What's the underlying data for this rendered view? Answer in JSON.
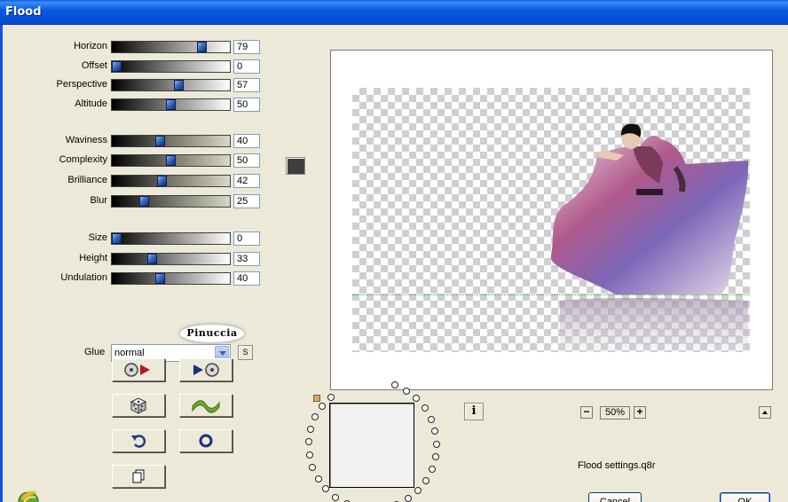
{
  "window": {
    "title": "Flood"
  },
  "params": [
    {
      "key": "horizon",
      "label": "Horizon",
      "value": "79",
      "fraction": 0.79
    },
    {
      "key": "offset",
      "label": "Offset",
      "value": "0",
      "fraction": 0.0
    },
    {
      "key": "perspective",
      "label": "Perspective",
      "value": "57",
      "fraction": 0.57
    },
    {
      "key": "altitude",
      "label": "Altitude",
      "value": "50",
      "fraction": 0.5
    },
    {
      "key": "waviness",
      "label": "Waviness",
      "value": "40",
      "fraction": 0.4
    },
    {
      "key": "complexity",
      "label": "Complexity",
      "value": "50",
      "fraction": 0.5
    },
    {
      "key": "brilliance",
      "label": "Brilliance",
      "value": "42",
      "fraction": 0.42
    },
    {
      "key": "blur",
      "label": "Blur",
      "value": "25",
      "fraction": 0.25
    },
    {
      "key": "size",
      "label": "Size",
      "value": "0",
      "fraction": 0.0
    },
    {
      "key": "height",
      "label": "Height",
      "value": "33",
      "fraction": 0.33
    },
    {
      "key": "undulation",
      "label": "Undulation",
      "value": "40",
      "fraction": 0.4
    }
  ],
  "colors": {
    "swatch": "#3e3e3e",
    "title_bar": "#0a55de",
    "water_line": "#3ab83a"
  },
  "logo": {
    "text": "Pinuccia"
  },
  "glue": {
    "label": "Glue",
    "value": "normal",
    "s_label": "S"
  },
  "tool_buttons": [
    "load-preset-icon",
    "save-preset-icon",
    "random-dice-icon",
    "wave-icon",
    "undo-icon",
    "reset-icon",
    "copy-icon"
  ],
  "zoom": {
    "value": "50%",
    "minus": "−",
    "plus": "+"
  },
  "info": {
    "label": "i"
  },
  "settings_file": "Flood settings.q8r",
  "buttons": {
    "cancel": "Cancel",
    "ok": "OK"
  }
}
